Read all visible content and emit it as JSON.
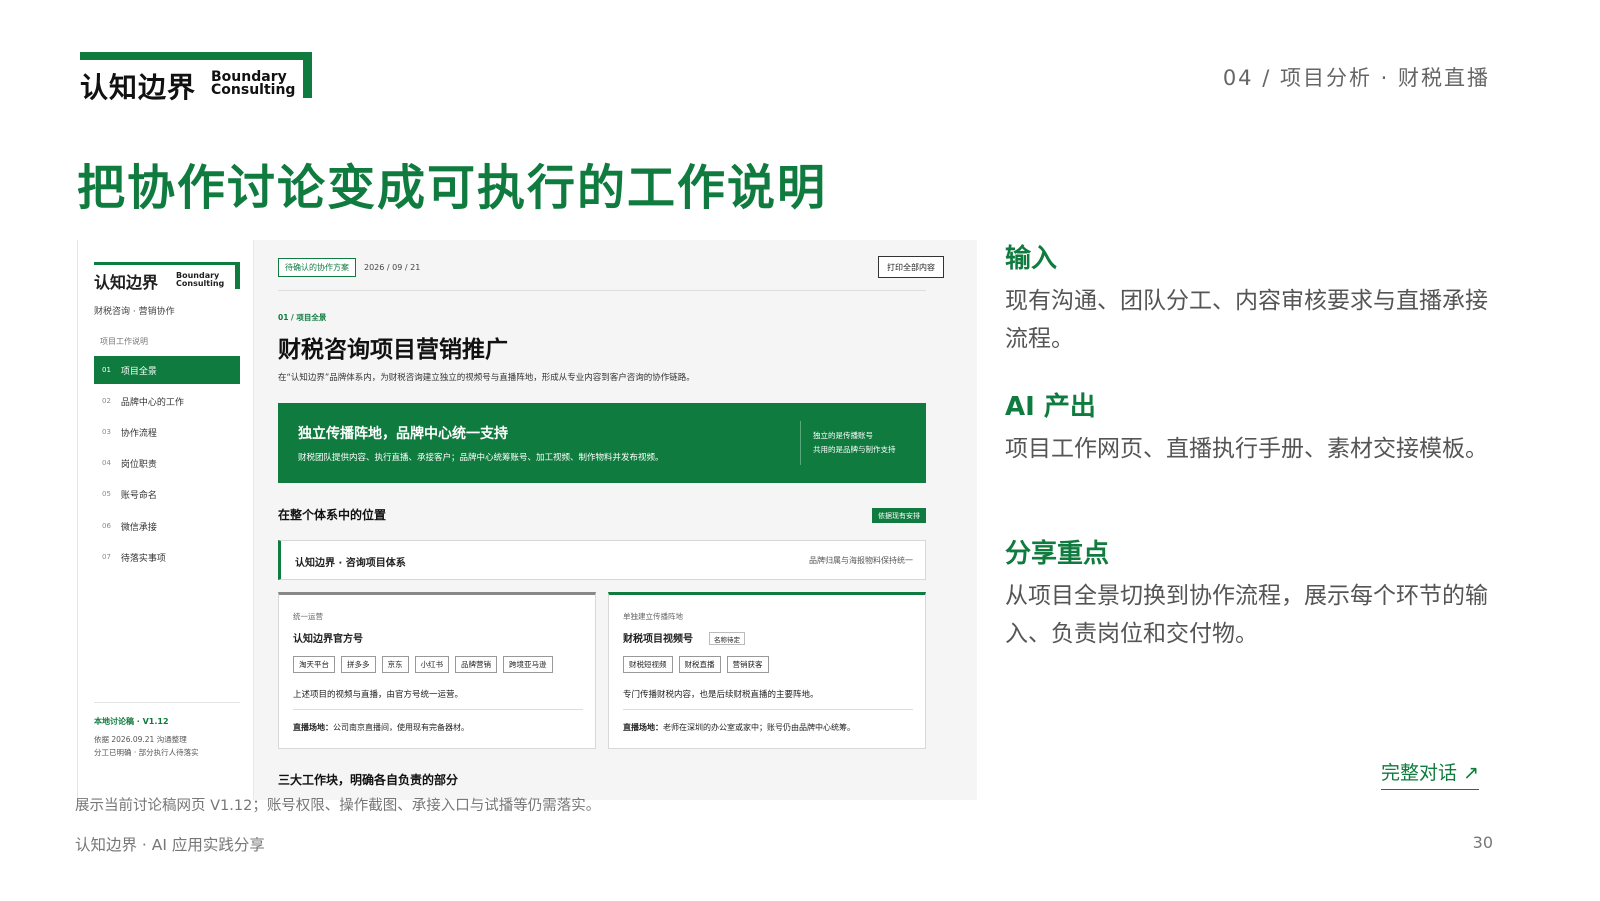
{
  "logo": {
    "cn": "认知边界",
    "en1": "Boundary",
    "en2": "Consulting"
  },
  "crumb": "04 / 项目分析 · 财税直播",
  "title": "把协作讨论变成可执行的工作说明",
  "screen": {
    "sidebar": {
      "sub": "财税咨询 · 营销协作",
      "group": "项目工作说明",
      "items": [
        {
          "num": "01",
          "label": "项目全景"
        },
        {
          "num": "02",
          "label": "品牌中心的工作"
        },
        {
          "num": "03",
          "label": "协作流程"
        },
        {
          "num": "04",
          "label": "岗位职责"
        },
        {
          "num": "05",
          "label": "账号命名"
        },
        {
          "num": "06",
          "label": "微信承接"
        },
        {
          "num": "07",
          "label": "待落实事项"
        }
      ],
      "version": "本地讨论稿 · V1.12",
      "vnote1": "依据 2026.09.21 沟通整理",
      "vnote2": "分工已明确 · 部分执行人待落实"
    },
    "main": {
      "pending": "待确认的协作方案",
      "date": "2026 / 09 / 21",
      "print": "打印全部内容",
      "kicker": "01 / 项目全景",
      "heading": "财税咨询项目营销推广",
      "desc": "在“认知边界”品牌体系内，为财税咨询建立独立的视频号与直播阵地，形成从专业内容到客户咨询的协作链路。",
      "banner_title": "独立传播阵地，品牌中心统一支持",
      "banner_desc": "财税团队提供内容、执行直播、承接客户；品牌中心统筹账号、加工视频、制作物料并发布视频。",
      "banner_r1": "独立的是传播账号",
      "banner_r2": "共用的是品牌与制作支持",
      "section": "在整个体系中的位置",
      "section_tag": "依据现有安排",
      "system_title": "认知边界 · 咨询项目体系",
      "system_note": "品牌归属与海报物料保持统一",
      "card1": {
        "kicker": "统一运营",
        "title": "认知边界官方号",
        "chips": [
          "淘天平台",
          "拼多多",
          "京东",
          "小红书",
          "品牌营销",
          "跨境亚马逊"
        ],
        "desc": "上述项目的视频与直播，由官方号统一运营。",
        "foot_label": "直播场地：",
        "foot": "公司南京直播间，使用现有完备器材。"
      },
      "card2": {
        "kicker": "单独建立传播阵地",
        "title": "财税项目视频号",
        "badge": "名称待定",
        "chips": [
          "财税短视频",
          "财税直播",
          "营销获客"
        ],
        "desc": "专门传播财税内容，也是后续财税直播的主要阵地。",
        "foot_label": "直播场地：",
        "foot": "老师在深圳的办公室或家中；账号仍由品牌中心统筹。"
      },
      "next_section": "三大工作块，明确各自负责的部分"
    }
  },
  "caption": "展示当前讨论稿网页 V1.12；账号权限、操作截图、承接入口与试播等仍需落实。",
  "right": [
    {
      "heading": "输入",
      "text": "现有沟通、团队分工、内容审核要求与直播承接流程。"
    },
    {
      "heading": "AI 产出",
      "text": "项目工作网页、直播执行手册、素材交接模板。"
    },
    {
      "heading": "分享重点",
      "text": "从项目全景切换到协作流程，展示每个环节的输入、负责岗位和交付物。"
    }
  ],
  "full_dialog": "完整对话 ↗",
  "footer": "认知边界 · AI 应用实践分享",
  "page_number": "30",
  "colors": {
    "brand": "#0f7b3e"
  }
}
